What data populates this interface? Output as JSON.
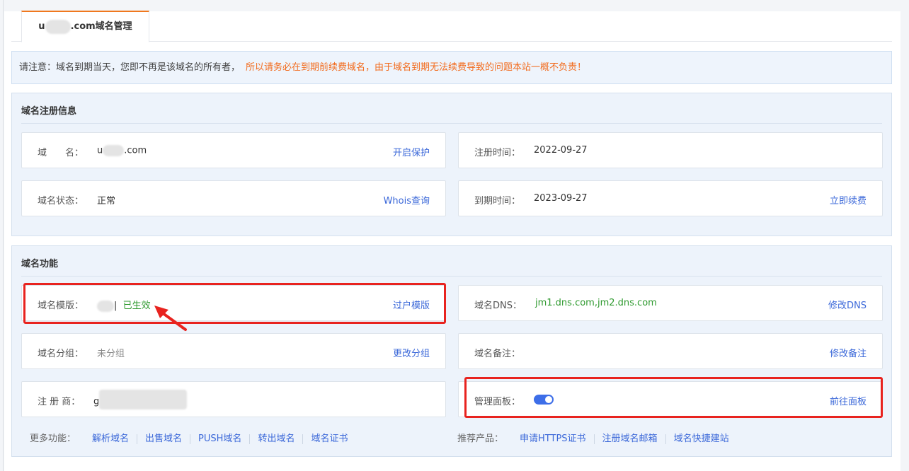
{
  "tab": {
    "prefix": "u",
    "suffix": ".com域名管理"
  },
  "notice": {
    "text": "请注意：域名到期当天，您即不再是该域名的所有者，",
    "warning": "所以请务必在到期前续费域名，由于域名到期无法续费导致的问题本站一概不负责！"
  },
  "registration": {
    "title": "域名注册信息",
    "domain": {
      "label": "域　　名：",
      "value_prefix": "u",
      "value_suffix": ".com",
      "action": "开启保护"
    },
    "reg_time": {
      "label": "注册时间：",
      "value": "2022-09-27"
    },
    "status": {
      "label": "域名状态：",
      "value": "正常",
      "action": "Whois查询"
    },
    "expire_time": {
      "label": "到期时间：",
      "value": "2023-09-27",
      "action": "立即续费"
    }
  },
  "features": {
    "title": "域名功能",
    "template": {
      "label": "域名模版：",
      "separator": "|",
      "value": "已生效",
      "action": "过户模版"
    },
    "dns": {
      "label": "域名DNS：",
      "value": "jm1.dns.com,jm2.dns.com",
      "action": "修改DNS"
    },
    "group": {
      "label": "域名分组：",
      "value": "未分组",
      "action": "更改分组"
    },
    "remark": {
      "label": "域名备注：",
      "action": "修改备注"
    },
    "registrar": {
      "label": "注 册 商：",
      "value_prefix": "g"
    },
    "panel": {
      "label": "管理面板：",
      "toggle_on": true,
      "action": "前往面板"
    },
    "more": {
      "label": "更多功能：",
      "links": [
        "解析域名",
        "出售域名",
        "PUSH域名",
        "转出域名",
        "域名证书"
      ]
    },
    "recommend": {
      "label": "推荐产品：",
      "links": [
        "申请HTTPS证书",
        "注册域名邮箱",
        "域名快捷建站"
      ]
    }
  },
  "colors": {
    "accent": "#3b68d9",
    "highlight": "#e8231f",
    "success": "#2f9a2f",
    "warning": "#f26b1d",
    "tab_top": "#f0781e"
  }
}
